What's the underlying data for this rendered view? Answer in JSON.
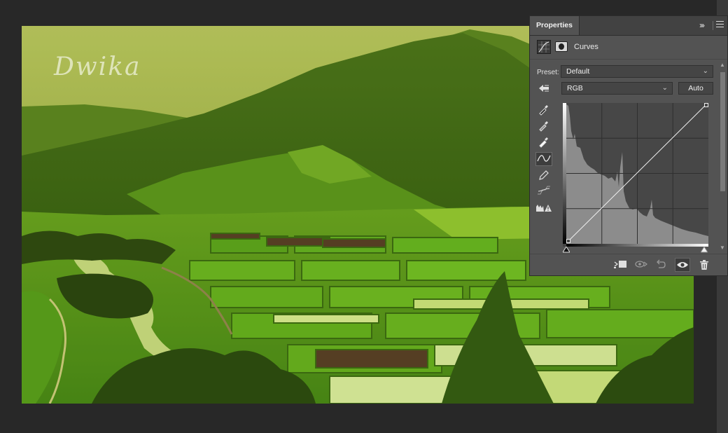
{
  "canvas": {
    "watermark_text": "Dwika",
    "photo_subject": "green terraced fields below a forested mountain"
  },
  "properties_panel": {
    "tab_label": "Properties",
    "adjustment_type": "Curves",
    "preset_label": "Preset:",
    "preset_value": "Default",
    "channel_value": "RGB",
    "auto_label": "Auto",
    "tools": [
      "sample-in-image-black-point-icon",
      "sample-in-image-gray-point-icon",
      "sample-in-image-white-point-icon",
      "edit-points-curve-icon",
      "draw-pencil-icon",
      "smooth-curve-icon",
      "clipping-warning-icon"
    ],
    "footer_icons": [
      "clip-to-layer-icon",
      "view-previous-state-icon",
      "reset-icon",
      "visibility-eye-icon",
      "delete-icon"
    ]
  },
  "colors": {
    "app_background": "#282828",
    "panel_background": "#535353",
    "accent_green": "#5c7a12"
  }
}
